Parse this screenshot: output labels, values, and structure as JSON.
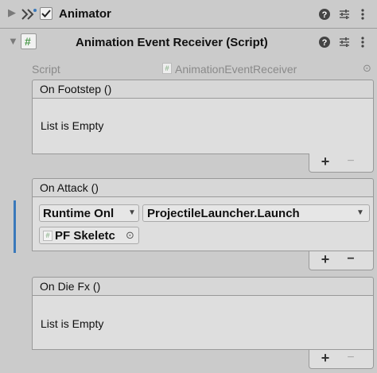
{
  "components": {
    "animator": {
      "title": "Animator"
    },
    "receiver": {
      "title": "Animation Event Receiver (Script)"
    }
  },
  "script_field": {
    "label": "Script",
    "value": "AnimationEventReceiver"
  },
  "events": [
    {
      "name": "On Footstep ()",
      "empty_text": "List is Empty",
      "add_label": "+",
      "remove_label": "−"
    },
    {
      "name": "On Attack ()",
      "runtime_mode": "Runtime Onl",
      "function": "ProjectileLauncher.Launch",
      "target_object": "PF Skeletc",
      "add_label": "+",
      "remove_label": "−"
    },
    {
      "name": "On Die Fx ()",
      "empty_text": "List is Empty",
      "add_label": "+",
      "remove_label": "−"
    }
  ],
  "icons": {
    "help": "help-icon",
    "presets": "presets-icon",
    "menu": "kebab-menu-icon",
    "script_file": "script-file-icon",
    "object_picker": "object-picker-icon"
  },
  "colors": {
    "inspector_bg": "#cbcbcb",
    "header_bg": "#d7d7d7",
    "selection_accent": "#3a79bb",
    "script_icon_green": "#4e9a4e"
  }
}
